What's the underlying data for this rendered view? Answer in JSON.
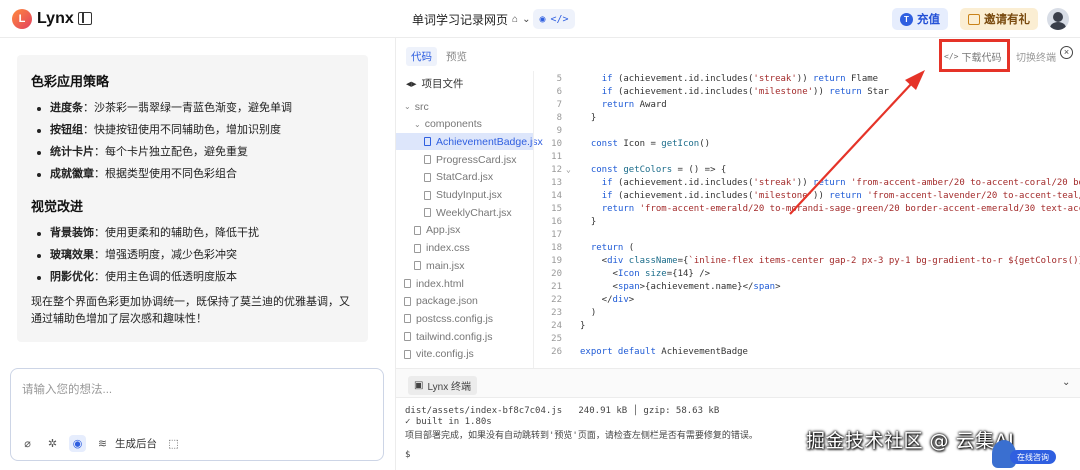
{
  "app": {
    "name": "Lynx",
    "logo_letter": "L"
  },
  "header": {
    "project_title": "单词学习记录网页",
    "charge_label": "充值",
    "invite_label": "邀请有礼"
  },
  "chat": {
    "section1_title": "色彩应用策略",
    "section1_items": [
      {
        "term": "进度条",
        "desc": "：沙茶彩一翡翠绿一青蓝色渐变，避免单调"
      },
      {
        "term": "按钮组",
        "desc": "：快捷按钮使用不同辅助色，增加识别度"
      },
      {
        "term": "统计卡片",
        "desc": "：每个卡片独立配色，避免重复"
      },
      {
        "term": "成就徽章",
        "desc": "：根据类型使用不同色彩组合"
      }
    ],
    "section2_title": "视觉改进",
    "section2_items": [
      {
        "term": "背景装饰",
        "desc": "：使用更柔和的辅助色，降低干扰"
      },
      {
        "term": "玻璃效果",
        "desc": "：增强透明度，减少色彩冲突"
      },
      {
        "term": "阴影优化",
        "desc": "：使用主色调的低透明度版本"
      }
    ],
    "summary": "现在整个界面色彩更加协调统一，既保持了莫兰迪的优雅基调，又通过辅助色增加了层次感和趣味性！",
    "input_placeholder": "请输入您的想法...",
    "generate_backend_label": "生成后台"
  },
  "code_panel": {
    "tab_code": "代码",
    "tab_preview": "预览",
    "download_label": "下载代码",
    "switch_terminal_label": "切换终端",
    "tree_title": "项目文件",
    "tree": [
      {
        "name": "src",
        "type": "folder",
        "depth": 0
      },
      {
        "name": "components",
        "type": "folder",
        "depth": 1
      },
      {
        "name": "AchievementBadge.jsx",
        "type": "file",
        "depth": 2,
        "selected": true
      },
      {
        "name": "ProgressCard.jsx",
        "type": "file",
        "depth": 2
      },
      {
        "name": "StatCard.jsx",
        "type": "file",
        "depth": 2
      },
      {
        "name": "StudyInput.jsx",
        "type": "file",
        "depth": 2
      },
      {
        "name": "WeeklyChart.jsx",
        "type": "file",
        "depth": 2
      },
      {
        "name": "App.jsx",
        "type": "file",
        "depth": 1
      },
      {
        "name": "index.css",
        "type": "file",
        "depth": 1
      },
      {
        "name": "main.jsx",
        "type": "file",
        "depth": 1
      },
      {
        "name": "index.html",
        "type": "file",
        "depth": 0
      },
      {
        "name": "package.json",
        "type": "file",
        "depth": 0
      },
      {
        "name": "postcss.config.js",
        "type": "file",
        "depth": 0
      },
      {
        "name": "tailwind.config.js",
        "type": "file",
        "depth": 0
      },
      {
        "name": "vite.config.js",
        "type": "file",
        "depth": 0
      }
    ],
    "code_lines": [
      {
        "n": "5",
        "fold": "",
        "html": "    <span class=\"kw\">if</span> (achievement.id.includes(<span class=\"str\">'streak'</span>)) <span class=\"kw\">return</span> Flame"
      },
      {
        "n": "6",
        "fold": "",
        "html": "    <span class=\"kw\">if</span> (achievement.id.includes(<span class=\"str\">'milestone'</span>)) <span class=\"kw\">return</span> Star"
      },
      {
        "n": "7",
        "fold": "",
        "html": "    <span class=\"kw\">return</span> Award"
      },
      {
        "n": "8",
        "fold": "",
        "html": "  }"
      },
      {
        "n": "9",
        "fold": "",
        "html": ""
      },
      {
        "n": "10",
        "fold": "",
        "html": "  <span class=\"kw\">const</span> Icon = <span class=\"fn\">getIcon</span>()"
      },
      {
        "n": "11",
        "fold": "",
        "html": ""
      },
      {
        "n": "12",
        "fold": "v",
        "html": "  <span class=\"kw\">const</span> <span class=\"fn\">getColors</span> = () => {"
      },
      {
        "n": "13",
        "fold": "",
        "html": "    <span class=\"kw\">if</span> (achievement.id.includes(<span class=\"str\">'streak'</span>)) <span class=\"kw\">return</span> <span class=\"str\">'from-accent-amber/20 to-accent-coral/20 border-accent-</span>"
      },
      {
        "n": "14",
        "fold": "",
        "html": "    <span class=\"kw\">if</span> (achievement.id.includes(<span class=\"str\">'milestone'</span>)) <span class=\"kw\">return</span> <span class=\"str\">'from-accent-lavender/20 to-accent-teal/20 border-ac</span>"
      },
      {
        "n": "15",
        "fold": "",
        "html": "    <span class=\"kw\">return</span> <span class=\"str\">'from-accent-emerald/20 to-morandi-sage-green/20 border-accent-emerald/30 text-accent-emerald'</span>"
      },
      {
        "n": "16",
        "fold": "",
        "html": "  }"
      },
      {
        "n": "17",
        "fold": "",
        "html": ""
      },
      {
        "n": "18",
        "fold": "",
        "html": "  <span class=\"kw\">return</span> ("
      },
      {
        "n": "19",
        "fold": "",
        "html": "    &lt;<span class=\"tg\">div</span> <span class=\"fn\">className</span>={<span class=\"str\">`inline-flex items-center gap-2 px-3 py-1 bg-gradient-to-r ${getColors()} rounded-ful</span>"
      },
      {
        "n": "20",
        "fold": "",
        "html": "      &lt;<span class=\"tg\">Icon</span> <span class=\"fn\">size</span>={14} />"
      },
      {
        "n": "21",
        "fold": "",
        "html": "      &lt;<span class=\"tg\">span</span>>{achievement.name}&lt;/<span class=\"tg\">span</span>>"
      },
      {
        "n": "22",
        "fold": "",
        "html": "    &lt;/<span class=\"tg\">div</span>>"
      },
      {
        "n": "23",
        "fold": "",
        "html": "  )"
      },
      {
        "n": "24",
        "fold": "",
        "html": "}"
      },
      {
        "n": "25",
        "fold": "",
        "html": ""
      },
      {
        "n": "26",
        "fold": "",
        "html": "<span class=\"kw\">export default</span> AchievementBadge"
      }
    ],
    "terminal_tab_label": "Lynx 终端",
    "terminal_lines": [
      "dist/assets/index-bf8c7c04.js   240.91 kB │ gzip: 58.63 kB",
      "✓ built in 1.80s",
      "项目部署完成，如果没有自动跳转到'预览'页面，请检查左侧栏是否有需要修复的错误。",
      "",
      "$"
    ]
  },
  "overlay": {
    "watermark": "掘金技术社区 @ 云集AI",
    "helper_label": "在线咨询",
    "arrow_color": "#e53328"
  }
}
